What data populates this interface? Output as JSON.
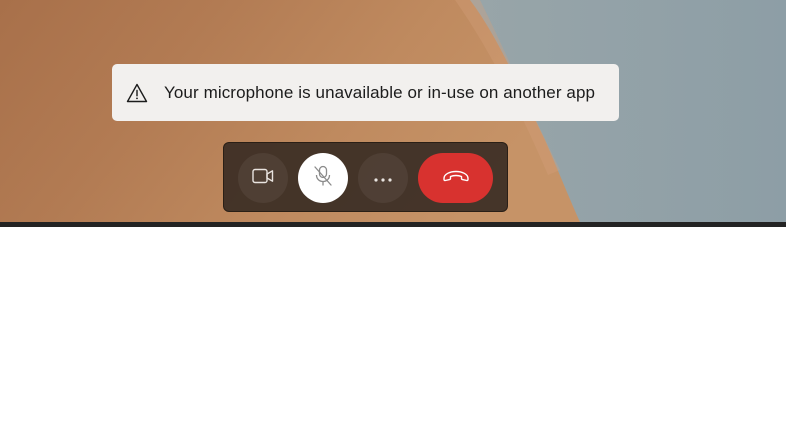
{
  "video": {
    "colors": {
      "skin_tone": "#b07a52",
      "background_gray": "#9aa6ab",
      "bottom_edge": "#232323"
    }
  },
  "notification": {
    "icon": "warning-triangle-icon",
    "message": "Your microphone is unavailable or in-use on another app",
    "background": "#f2f0ee"
  },
  "call_controls": {
    "buttons": [
      {
        "name": "camera",
        "icon": "video-camera-icon",
        "state": "on"
      },
      {
        "name": "microphone",
        "icon": "microphone-off-icon",
        "state": "muted"
      },
      {
        "name": "more",
        "icon": "more-horizontal-icon"
      },
      {
        "name": "end-call",
        "icon": "phone-hangup-icon",
        "color": "#d8322f"
      }
    ]
  }
}
